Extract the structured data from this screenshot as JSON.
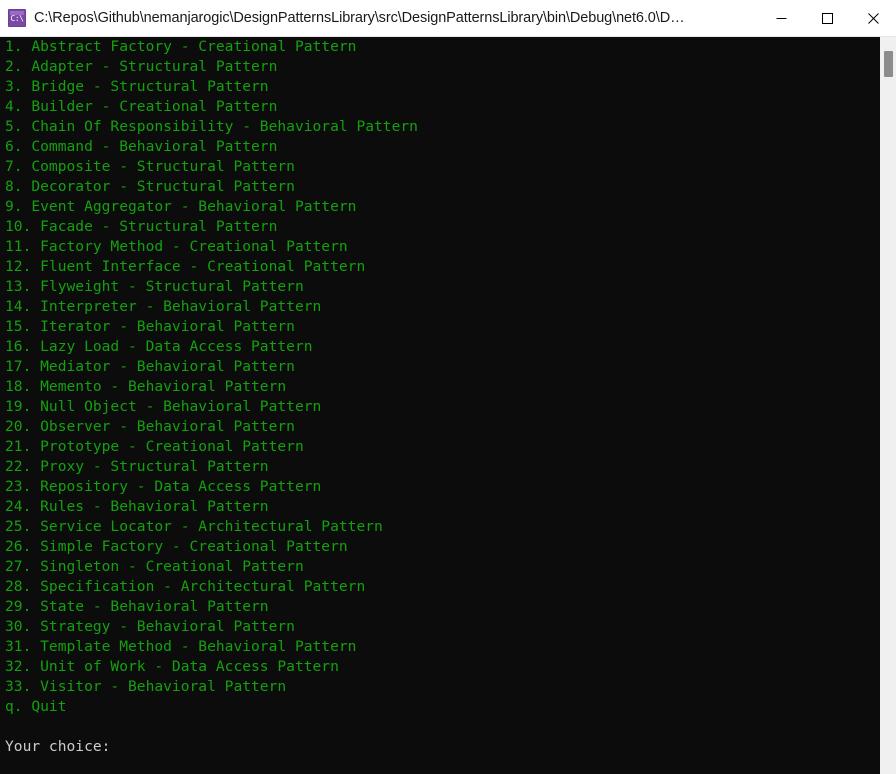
{
  "window": {
    "title": "C:\\Repos\\Github\\nemanjarogic\\DesignPatternsLibrary\\src\\DesignPatternsLibrary\\bin\\Debug\\net6.0\\D…",
    "icon_glyph": "C:\\",
    "background_color": "#0c0c0c",
    "titlebar_color": "#ffffff",
    "controls": {
      "minimize_label": "Minimize",
      "maximize_label": "Maximize",
      "close_label": "Close"
    }
  },
  "console": {
    "foreground_color": "#13a10e",
    "prompt_color": "#cccccc",
    "lines": [
      "1. Abstract Factory - Creational Pattern",
      "2. Adapter - Structural Pattern",
      "3. Bridge - Structural Pattern",
      "4. Builder - Creational Pattern",
      "5. Chain Of Responsibility - Behavioral Pattern",
      "6. Command - Behavioral Pattern",
      "7. Composite - Structural Pattern",
      "8. Decorator - Structural Pattern",
      "9. Event Aggregator - Behavioral Pattern",
      "10. Facade - Structural Pattern",
      "11. Factory Method - Creational Pattern",
      "12. Fluent Interface - Creational Pattern",
      "13. Flyweight - Structural Pattern",
      "14. Interpreter - Behavioral Pattern",
      "15. Iterator - Behavioral Pattern",
      "16. Lazy Load - Data Access Pattern",
      "17. Mediator - Behavioral Pattern",
      "18. Memento - Behavioral Pattern",
      "19. Null Object - Behavioral Pattern",
      "20. Observer - Behavioral Pattern",
      "21. Prototype - Creational Pattern",
      "22. Proxy - Structural Pattern",
      "23. Repository - Data Access Pattern",
      "24. Rules - Behavioral Pattern",
      "25. Service Locator - Architectural Pattern",
      "26. Simple Factory - Creational Pattern",
      "27. Singleton - Creational Pattern",
      "28. Specification - Architectural Pattern",
      "29. State - Behavioral Pattern",
      "30. Strategy - Behavioral Pattern",
      "31. Template Method - Behavioral Pattern",
      "32. Unit of Work - Data Access Pattern",
      "33. Visitor - Behavioral Pattern",
      "q. Quit"
    ],
    "blank_line": "",
    "prompt": "Your choice:"
  },
  "scrollbar": {
    "track_color": "#f0f0f0",
    "thumb_color": "#8c8c8c"
  }
}
